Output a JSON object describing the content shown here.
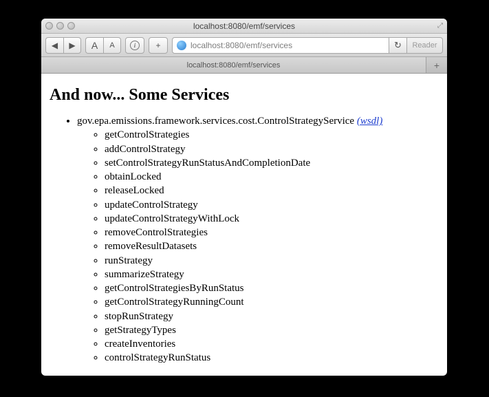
{
  "window": {
    "title": "localhost:8080/emf/services",
    "url": "localhost:8080/emf/services"
  },
  "tabs": {
    "active": "localhost:8080/emf/services"
  },
  "reader_label": "Reader",
  "page": {
    "heading": "And now... Some Services",
    "service": {
      "name": "gov.epa.emissions.framework.services.cost.ControlStrategyService",
      "wsdl_label": "(wsdl)",
      "methods": [
        "getControlStrategies",
        "addControlStrategy",
        "setControlStrategyRunStatusAndCompletionDate",
        "obtainLocked",
        "releaseLocked",
        "updateControlStrategy",
        "updateControlStrategyWithLock",
        "removeControlStrategies",
        "removeResultDatasets",
        "runStrategy",
        "summarizeStrategy",
        "getControlStrategiesByRunStatus",
        "getControlStrategyRunningCount",
        "stopRunStrategy",
        "getStrategyTypes",
        "createInventories",
        "controlStrategyRunStatus"
      ]
    }
  }
}
